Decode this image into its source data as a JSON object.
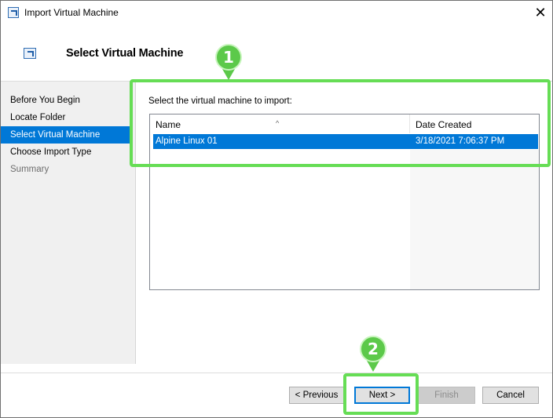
{
  "window": {
    "title": "Import Virtual Machine",
    "close_glyph": "✕"
  },
  "header": {
    "title": "Select Virtual Machine"
  },
  "nav": {
    "items": [
      {
        "label": "Before You Begin",
        "state": "normal"
      },
      {
        "label": "Locate Folder",
        "state": "normal"
      },
      {
        "label": "Select Virtual Machine",
        "state": "active"
      },
      {
        "label": "Choose Import Type",
        "state": "normal"
      },
      {
        "label": "Summary",
        "state": "disabled"
      }
    ]
  },
  "main": {
    "prompt": "Select the virtual machine to import:",
    "columns": [
      "Name",
      "Date Created"
    ],
    "sort_indicator": "^",
    "rows": [
      {
        "name": "Alpine Linux 01",
        "date_created": "3/18/2021 7:06:37 PM",
        "selected": true
      }
    ]
  },
  "buttons": {
    "previous": "< Previous",
    "next": "Next >",
    "finish": "Finish",
    "cancel": "Cancel"
  },
  "annotations": {
    "marker_1": "1",
    "marker_2": "2",
    "highlight_color": "#66dd55"
  },
  "colors": {
    "accent": "#0078d7",
    "nav_background": "#f0f0f0"
  }
}
